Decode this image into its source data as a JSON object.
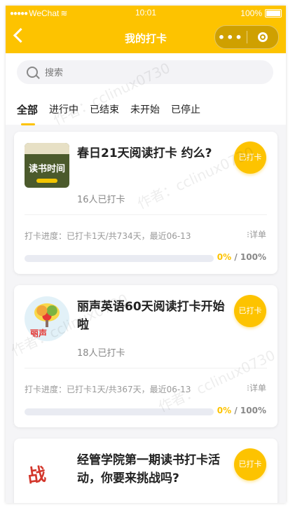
{
  "statusbar": {
    "carrier": "WeChat",
    "time": "10:01",
    "battery": "100%"
  },
  "navbar": {
    "title": "我的打卡"
  },
  "search": {
    "placeholder": "搜索"
  },
  "tabs": [
    {
      "label": "全部",
      "active": true
    },
    {
      "label": "进行中",
      "active": false
    },
    {
      "label": "已结束",
      "active": false
    },
    {
      "label": "未开始",
      "active": false
    },
    {
      "label": "已停止",
      "active": false
    }
  ],
  "cards": [
    {
      "title": "春日21天阅读打卡 约么?",
      "thumb_text": "读书时间",
      "count": "16人已打卡",
      "checkin": "已打卡",
      "progress_text": "打卡进度：已打卡1天/共734天，最近06-13",
      "detail": "详单",
      "progress_current": "0%",
      "progress_total": "100%",
      "progress_fraction": 0
    },
    {
      "title": "丽声英语60天阅读打卡开始啦",
      "thumb_text": "丽声",
      "count": "18人已打卡",
      "checkin": "已打卡",
      "progress_text": "打卡进度：已打卡1天/共367天，最近06-13",
      "detail": "详单",
      "progress_current": "0%",
      "progress_total": "100%",
      "progress_fraction": 0
    },
    {
      "title": "经管学院第一期读书打卡活动，你要来挑战吗?",
      "thumb_text": "战",
      "count": "",
      "checkin": "已打卡"
    }
  ],
  "watermark": "作者：cclinux0730"
}
